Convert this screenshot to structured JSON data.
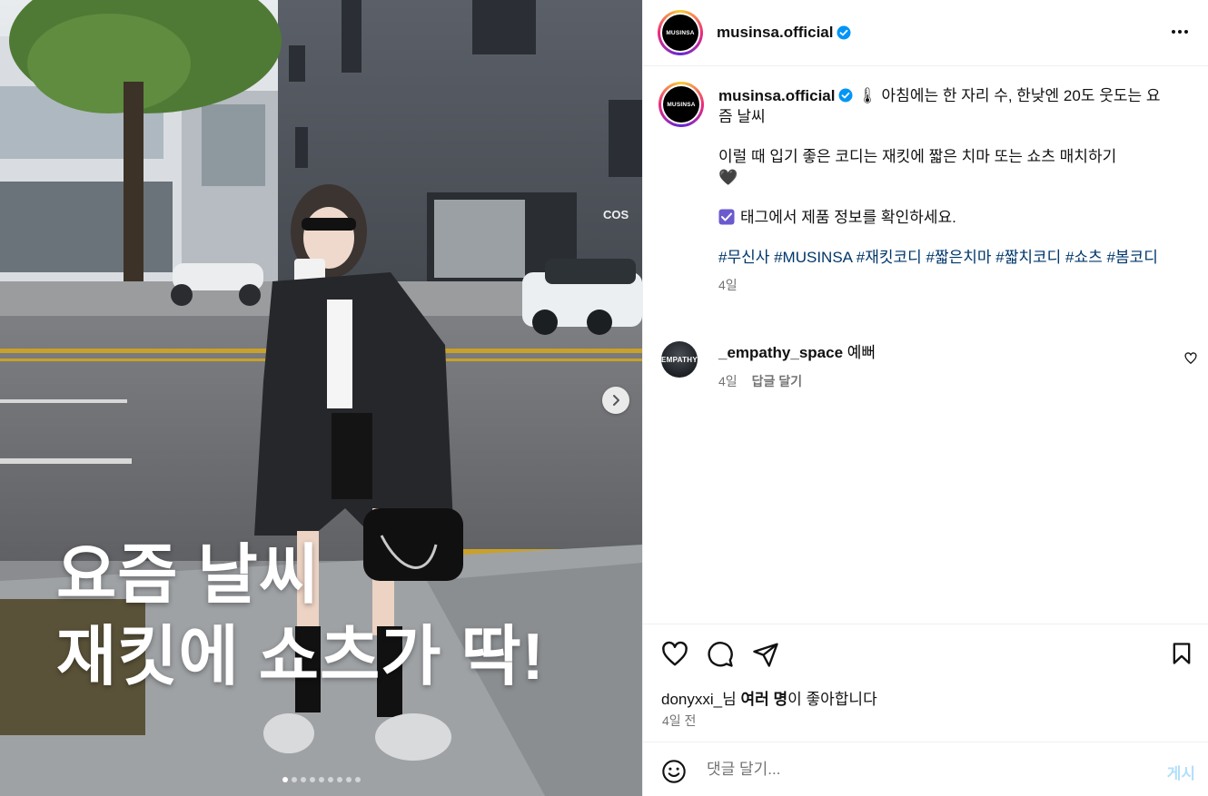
{
  "post": {
    "overlay_line1": "요즘 날씨",
    "overlay_line2": "재킷에 쇼츠가 딱!",
    "store_sign": "COS",
    "carousel_total": 9,
    "carousel_active": 1
  },
  "header": {
    "username": "musinsa.official",
    "avatar_text": "MUSINSA"
  },
  "caption": {
    "username": "musinsa.official",
    "emoji": "🌡",
    "line1": "아침에는 한 자리 수, 한낮엔 20도 웃도는 요즘 날씨",
    "line2": "이럴 때 입기 좋은 코디는 재킷에 짧은 치마 또는 쇼츠 매치하기",
    "heart": "🖤",
    "line3": "태그에서 제품 정보를 확인하세요.",
    "hashtags": "#무신사 #MUSINSA #재킷코디 #짧은치마 #짧치코디 #쇼츠 #봄코디",
    "time": "4일"
  },
  "comment": {
    "avatar_text": "EMPATHY",
    "username": "_empathy_space",
    "text": "예뻐",
    "time": "4일",
    "reply_label": "답글 달기"
  },
  "likes": {
    "user": "donyxxi_",
    "suffix1": "님 ",
    "others": "여러 명",
    "suffix2": "이 좋아합니다"
  },
  "date": "4일 전",
  "comment_box": {
    "placeholder": "댓글 달기...",
    "post_label": "게시"
  }
}
